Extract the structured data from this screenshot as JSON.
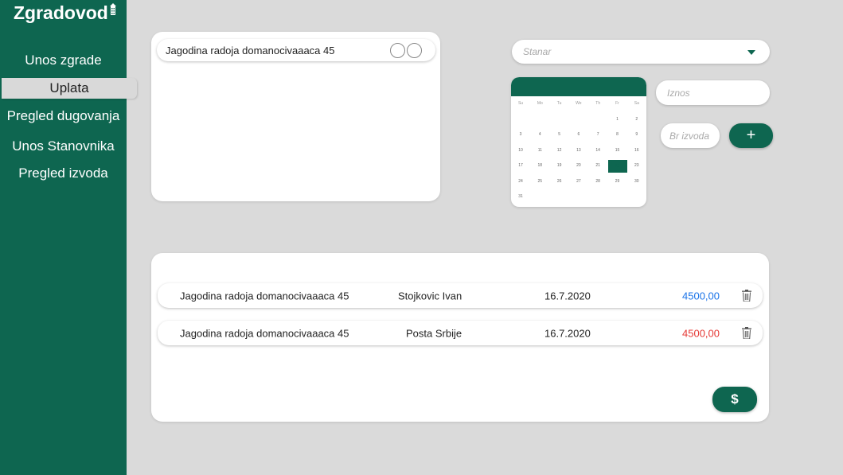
{
  "app": {
    "title": "Zgradovod"
  },
  "sidebar": {
    "items": [
      {
        "label": "Unos zgrade"
      },
      {
        "label": "Uplata"
      },
      {
        "label": "Pregled dugovanja"
      },
      {
        "label": "Unos Stanovnika"
      },
      {
        "label": "Pregled izvoda"
      }
    ],
    "active_index": 1
  },
  "building_card": {
    "selected_building": "Jagodina radoja domanocivaaaca 45"
  },
  "form": {
    "resident_placeholder": "Stanar",
    "amount_placeholder": "Iznos",
    "statement_placeholder": "Br izvoda",
    "add_label": "+",
    "calendar": {
      "weekdays": [
        "Su",
        "Mo",
        "Tu",
        "We",
        "Th",
        "Fr",
        "Sa"
      ],
      "weeks": [
        [
          "",
          "",
          "",
          "",
          "",
          "1",
          "2"
        ],
        [
          "3",
          "4",
          "5",
          "6",
          "7",
          "8",
          "9"
        ],
        [
          "10",
          "11",
          "12",
          "13",
          "14",
          "15",
          "16"
        ],
        [
          "17",
          "18",
          "19",
          "20",
          "21",
          "22",
          "23"
        ],
        [
          "24",
          "25",
          "26",
          "27",
          "28",
          "29",
          "30"
        ],
        [
          "31",
          "",
          "",
          "",
          "",
          "",
          ""
        ]
      ],
      "selected_day": "22"
    }
  },
  "payments": {
    "rows": [
      {
        "building": "Jagodina radoja domanocivaaaca 45",
        "payer": "Stojkovic Ivan",
        "date": "16.7.2020",
        "amount": "4500,00",
        "amount_color": "#1a73e8"
      },
      {
        "building": "Jagodina radoja domanocivaaaca 45",
        "payer": "Posta Srbije",
        "date": "16.7.2020",
        "amount": "4500,00",
        "amount_color": "#e53935"
      }
    ],
    "pay_label": "$"
  },
  "colors": {
    "brand": "#0e6650",
    "background": "#dadada"
  },
  "icons": [
    "building-icon",
    "dropdown-arrow-icon",
    "trash-icon",
    "plus-icon",
    "dollar-icon"
  ]
}
